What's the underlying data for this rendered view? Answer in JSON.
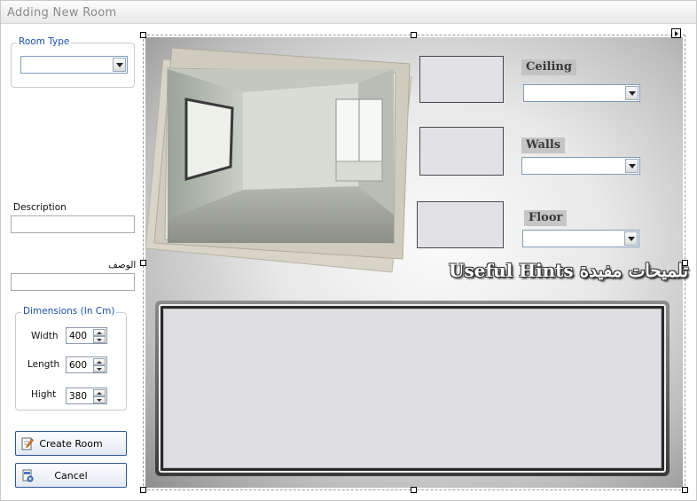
{
  "window": {
    "title": "Adding New Room"
  },
  "room_type": {
    "legend": "Room Type",
    "value": ""
  },
  "description": {
    "label": "Description",
    "value": ""
  },
  "description_ar": {
    "label": "الوصف",
    "value": ""
  },
  "dimensions": {
    "legend": "Dimensions (In Cm)",
    "width": {
      "label": "Width",
      "value": "400"
    },
    "length": {
      "label": "Length",
      "value": "600"
    },
    "hight": {
      "label": "Hight",
      "value": "380"
    }
  },
  "buttons": {
    "create": "Create Room",
    "cancel": "Cancel"
  },
  "surfaces": {
    "ceiling": {
      "label": "Ceiling",
      "value": ""
    },
    "walls": {
      "label": "Walls",
      "value": ""
    },
    "floor": {
      "label": "Floor",
      "value": ""
    }
  },
  "hints": {
    "title": "Useful Hints  تلميحات مفيدة",
    "text": ""
  },
  "icons": {
    "create": "edit-icon",
    "cancel": "cancel-icon",
    "dropdown": "chevron-down-icon",
    "spin_up": "arrow-up-icon",
    "spin_down": "arrow-down-icon"
  }
}
